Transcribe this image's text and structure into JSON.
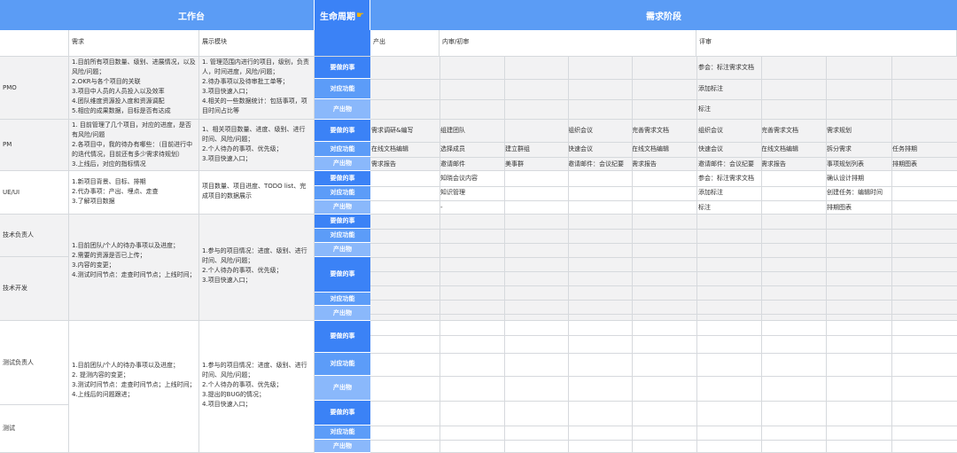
{
  "headers": {
    "workbench": "工作台",
    "lifecycle": "生命周期",
    "lifecycle_icon": "pointing-hand-icon",
    "demand": "需求阶段"
  },
  "subheaders": {
    "demand": "需求",
    "module": "展示模块",
    "output": "产出",
    "review": "内审/初审",
    "assess": "评审"
  },
  "row_labels": {
    "todo": "要做的事",
    "func": "对应功能",
    "product": "产出物"
  },
  "roles": [
    "PMO",
    "PM",
    "UE/UI",
    "技术负责人",
    "技术开发",
    "测试负责人",
    "测试"
  ],
  "pmo": {
    "demand": "1.目前所有项目数量、级别、进展情况，以及风险/问题；\n2.OKR与各个项目的关联\n3.项目中人员的人员投入以及效率\n4.团队维度资源投入度和资源调配\n5.相应的成果数据，目标是否有达成",
    "module": "1. 管理范围内进行的项目，级别，负责人，时间进度，风险/问题；\n2.待办事项以及待审批工单等；\n3.项目快速入口；\n4.相关的一些数据统计：包括事项，项目时间占比等",
    "todo": "参会：标注需求文档",
    "func": "添加标注",
    "product": "标注"
  },
  "pm": {
    "demand": "1. 目前管理了几个项目，对应的进度，是否有风险/问题\n2.各项目中，我的待办有哪些：（目前进行中的迭代情况，目前还有多少需求待规划）\n3.上线后，对应的指标情况",
    "module": "1、相关项目数量、进度、级别、进行时间、风险/问题；\n2.个人待办的事项、优先级；\n3.项目快速入口；",
    "todo": [
      "需求调研&编写",
      "组建团队",
      "组织会议",
      "完善需求文档",
      "组织会议",
      "完善需求文档",
      "需求规划"
    ],
    "func": [
      "在线文档编辑",
      "选择成员",
      "建立群组",
      "快速会议",
      "在线文档编辑",
      "快速会议",
      "在线文档编辑",
      "拆分需求",
      "任务排期"
    ],
    "product": [
      "需求报告",
      "邀请邮件",
      "美事群",
      "邀请邮件：会议纪要",
      "需求报告",
      "邀请邮件：会议纪要",
      "需求报告",
      "事项规划列表",
      "排期图表"
    ]
  },
  "ueui": {
    "demand": "1.新项目背景、目标、排期\n2.代办事项：产出、埋点、走查\n3.了解项目数据",
    "module": "项目数量、项目进度、TODO list、完成项目的数据展示",
    "todo": [
      "知晓会议内容",
      "参会：标注需求文档",
      "确认设计排期"
    ],
    "func": [
      "知识管理",
      "添加标注",
      "创建任务：编辑时间"
    ],
    "product": [
      "-",
      "标注",
      "排期图表"
    ]
  },
  "tech": {
    "demand": "1.目前团队/个人的待办事项以及进度；\n2.需要的资源是否已上传；\n3.内容的变更；\n4.测试时间节点：走查时间节点；上线时间；",
    "module": "1.参与的项目情况：进度、级别、进行时间、风险/问题；\n2.个人待办的事项、优先级；\n3.项目快速入口；"
  },
  "test": {
    "demand": "1.目前团队/个人的待办事项以及进度；\n2. 提测内容的变更；\n3.测试时间节点：走查时间节点；上线时间；\n4.上线后的问题跟进；",
    "module": "1.参与的项目情况：进度、级别、进行时间、风险/问题；\n2.个人待办的事项、优先级；\n3.提出的BUG的情况；\n4.项目快速入口；"
  },
  "colors": {
    "header_blue": "#5b9cf5",
    "lifecycle_blue": "#3b82f6",
    "func_blue": "#5c9cf8",
    "product_blue": "#8ab8fb",
    "grey_band": "#f2f2f3"
  }
}
